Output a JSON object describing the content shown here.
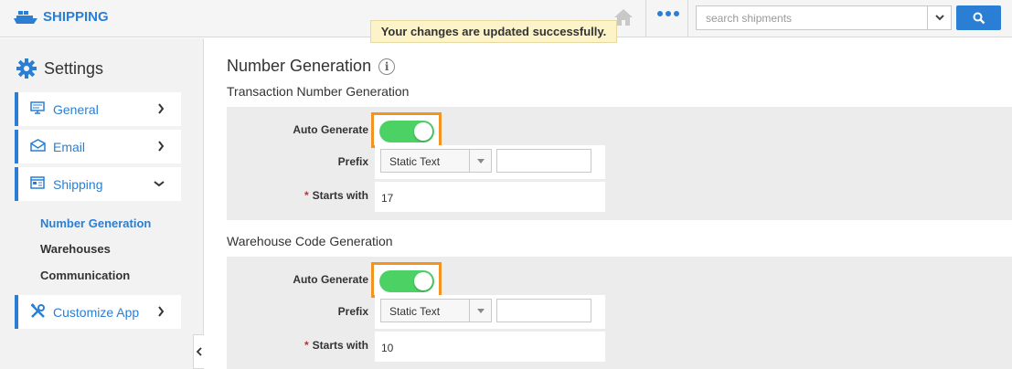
{
  "header": {
    "app_name": "SHIPPING",
    "notification": "Your changes are updated successfully.",
    "search_placeholder": "search shipments"
  },
  "sidebar": {
    "title": "Settings",
    "items": [
      {
        "label": "General",
        "icon": "monitor-icon"
      },
      {
        "label": "Email",
        "icon": "envelope-icon"
      },
      {
        "label": "Shipping",
        "icon": "window-icon"
      },
      {
        "label": "Customize App",
        "icon": "tools-icon"
      }
    ],
    "sub_items": [
      {
        "label": "Number Generation",
        "active": true
      },
      {
        "label": "Warehouses",
        "active": false
      },
      {
        "label": "Communication",
        "active": false
      }
    ]
  },
  "main": {
    "title": "Number Generation",
    "sections": [
      {
        "title": "Transaction Number Generation",
        "auto_generate_label": "Auto Generate",
        "auto_generate_on": true,
        "prefix_label": "Prefix",
        "prefix_type": "Static Text",
        "prefix_value": "",
        "starts_with_label": "Starts with",
        "starts_with_value": "17"
      },
      {
        "title": "Warehouse Code Generation",
        "auto_generate_label": "Auto Generate",
        "auto_generate_on": true,
        "prefix_label": "Prefix",
        "prefix_type": "Static Text",
        "prefix_value": "",
        "starts_with_label": "Starts with",
        "starts_with_value": "10"
      }
    ]
  },
  "colors": {
    "accent": "#2a7fd4",
    "toggle_on": "#4cd264",
    "highlight": "#f29422",
    "notice_bg": "#fcf3c8",
    "required": "#d9232e"
  }
}
